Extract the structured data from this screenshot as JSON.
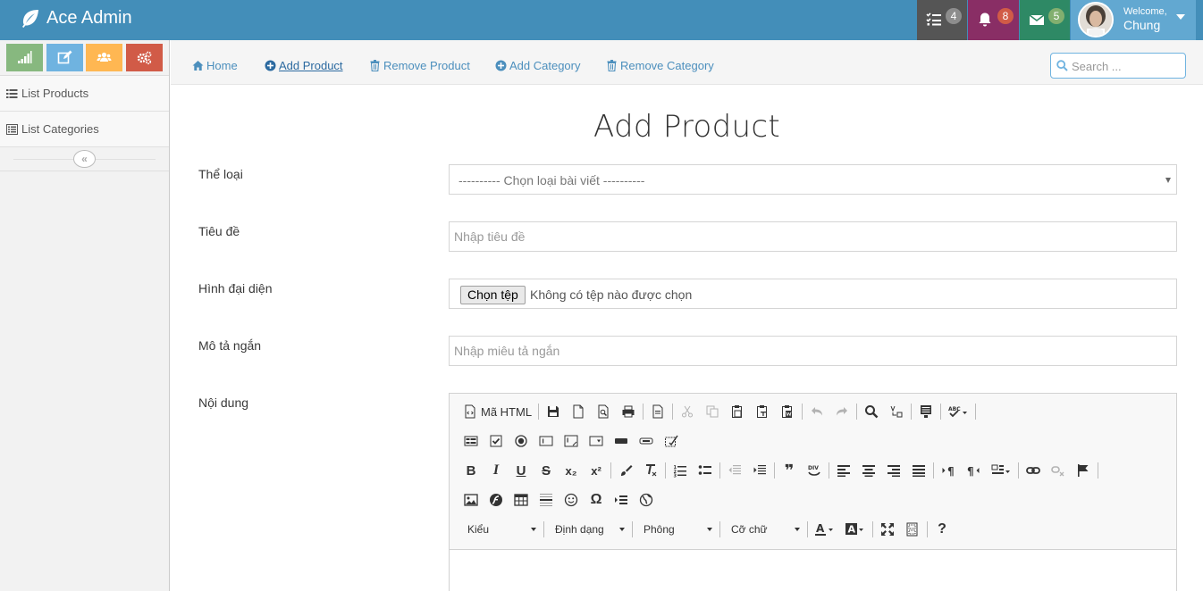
{
  "app": {
    "title": "Ace Admin"
  },
  "navbar": {
    "tasks_count": "4",
    "notifications_count": "8",
    "messages_count": "5",
    "welcome": "Welcome,",
    "user_name": "Chung",
    "colors": {
      "bar": "#438eb9",
      "tasks": "#555555",
      "notifications": "#892e65",
      "messages": "#2e8965",
      "user": "#62a8d1"
    }
  },
  "sidebar": {
    "shortcut_icons": [
      "signal-icon",
      "pencil-icon",
      "users-icon",
      "cogs-icon"
    ],
    "items": [
      {
        "label": "List Products",
        "icon": "list-icon"
      },
      {
        "label": "List Categories",
        "icon": "list-alt-icon"
      }
    ],
    "collapse_glyph": "«"
  },
  "breadcrumb": {
    "items": [
      {
        "label": "Home",
        "icon": "home-icon"
      },
      {
        "label": "Add Product",
        "icon": "plus-circle-icon",
        "active": true
      },
      {
        "label": "Remove Product",
        "icon": "trash-icon"
      },
      {
        "label": "Add Category",
        "icon": "plus-circle-icon"
      },
      {
        "label": "Remove Category",
        "icon": "trash-icon"
      }
    ],
    "search_placeholder": "Search ..."
  },
  "form": {
    "title": "Add Product",
    "category_label": "Thể loại",
    "category_value": "---------- Chọn loại bài viết ----------",
    "title_label": "Tiêu đề",
    "title_placeholder": "Nhập tiêu đề",
    "image_label": "Hình đại diện",
    "file_button": "Chọn tệp",
    "file_status": "Không có tệp nào được chọn",
    "summary_label": "Mô tả ngắn",
    "summary_placeholder": "Nhập miêu tả ngắn",
    "content_label": "Nội dung"
  },
  "editor": {
    "source_label": "Mã HTML",
    "bold": "B",
    "italic": "I",
    "underline": "U",
    "strike": "S",
    "subscript": "x₂",
    "superscript": "x²",
    "quote": "❞",
    "special_char": "Ω",
    "help": "?",
    "combos": {
      "style": "Kiểu",
      "format": "Định dạng",
      "font": "Phông",
      "size": "Cỡ chữ"
    }
  }
}
